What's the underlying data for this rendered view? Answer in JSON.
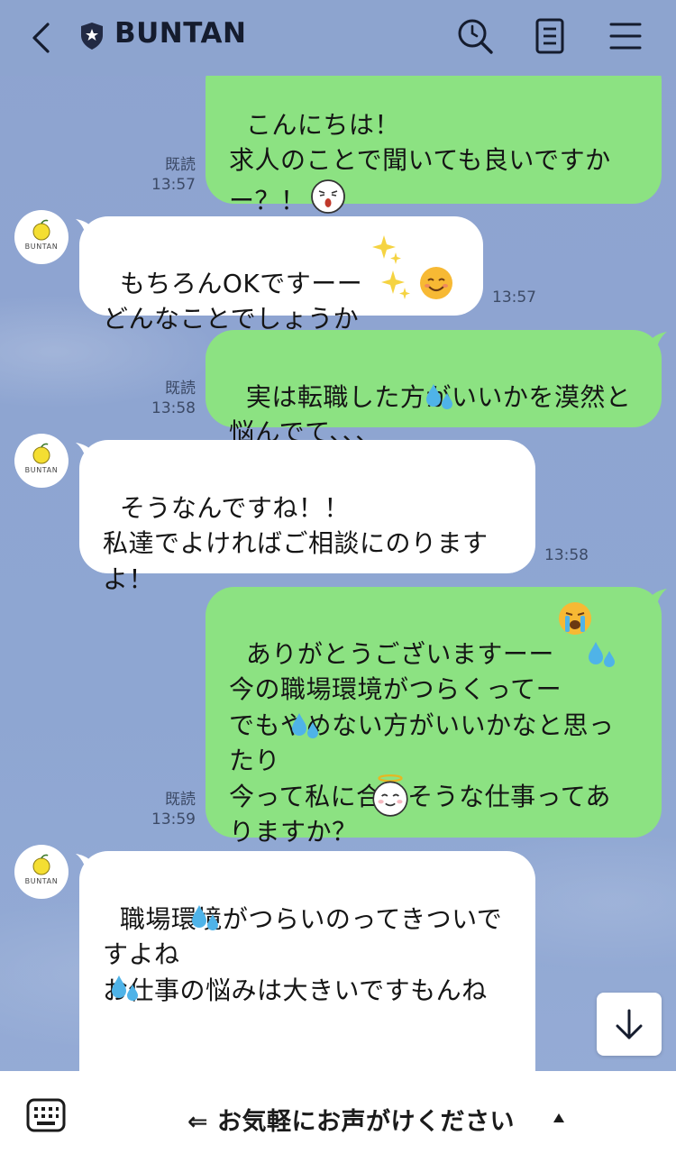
{
  "header": {
    "title": "BUNTAN",
    "back_icon": "chevron-left-icon",
    "room_icon": "shield-star-icon",
    "actions": [
      "search-icon",
      "notes-icon",
      "menu-icon"
    ]
  },
  "avatar": {
    "label": "BUNTAN"
  },
  "messages": [
    {
      "side": "out",
      "text": "こんにちは！\n求人のことで聞いても良いですか\nー？！",
      "read": "既読",
      "time": "13:57",
      "emoji": "shocked-face-sticker-icon"
    },
    {
      "side": "in",
      "text": "もちろんOKですーー\nどんなことでしょうか",
      "time": "13:57",
      "emoji": "sparkles-smiling-face-icon"
    },
    {
      "side": "out",
      "text": "実は転職した方がいいかを漠然と\n悩んでて、、、",
      "read": "既読",
      "time": "13:58",
      "emoji": "sweat-droplets-icon"
    },
    {
      "side": "in",
      "text": "そうなんですね！！\n私達でよければご相談にのります\nよ！",
      "time": "13:58"
    },
    {
      "side": "out",
      "text": "ありがとうございますーー\n今の職場環境がつらくってー\nでもやめない方がいいかなと思っ\nたり\n今って私に合いそうな仕事ってあ\nりますか？",
      "read": "既読",
      "time": "13:59",
      "emoji": "crying-sweat-angel-icons"
    },
    {
      "side": "in",
      "text": "職場環境がつらいのってきついで\nすよね\nお仕事の悩みは大きいですもんね\n\n\nお仕事はご縁とタイミングなので"
    }
  ],
  "scroll_button": "arrow-down-icon",
  "bottom": {
    "keyboard_icon": "keyboard-icon",
    "label": "⇐ お気軽にお声がけください"
  },
  "colors": {
    "background": "#8da4cf",
    "outgoing": "#8ce282",
    "incoming": "#ffffff"
  }
}
